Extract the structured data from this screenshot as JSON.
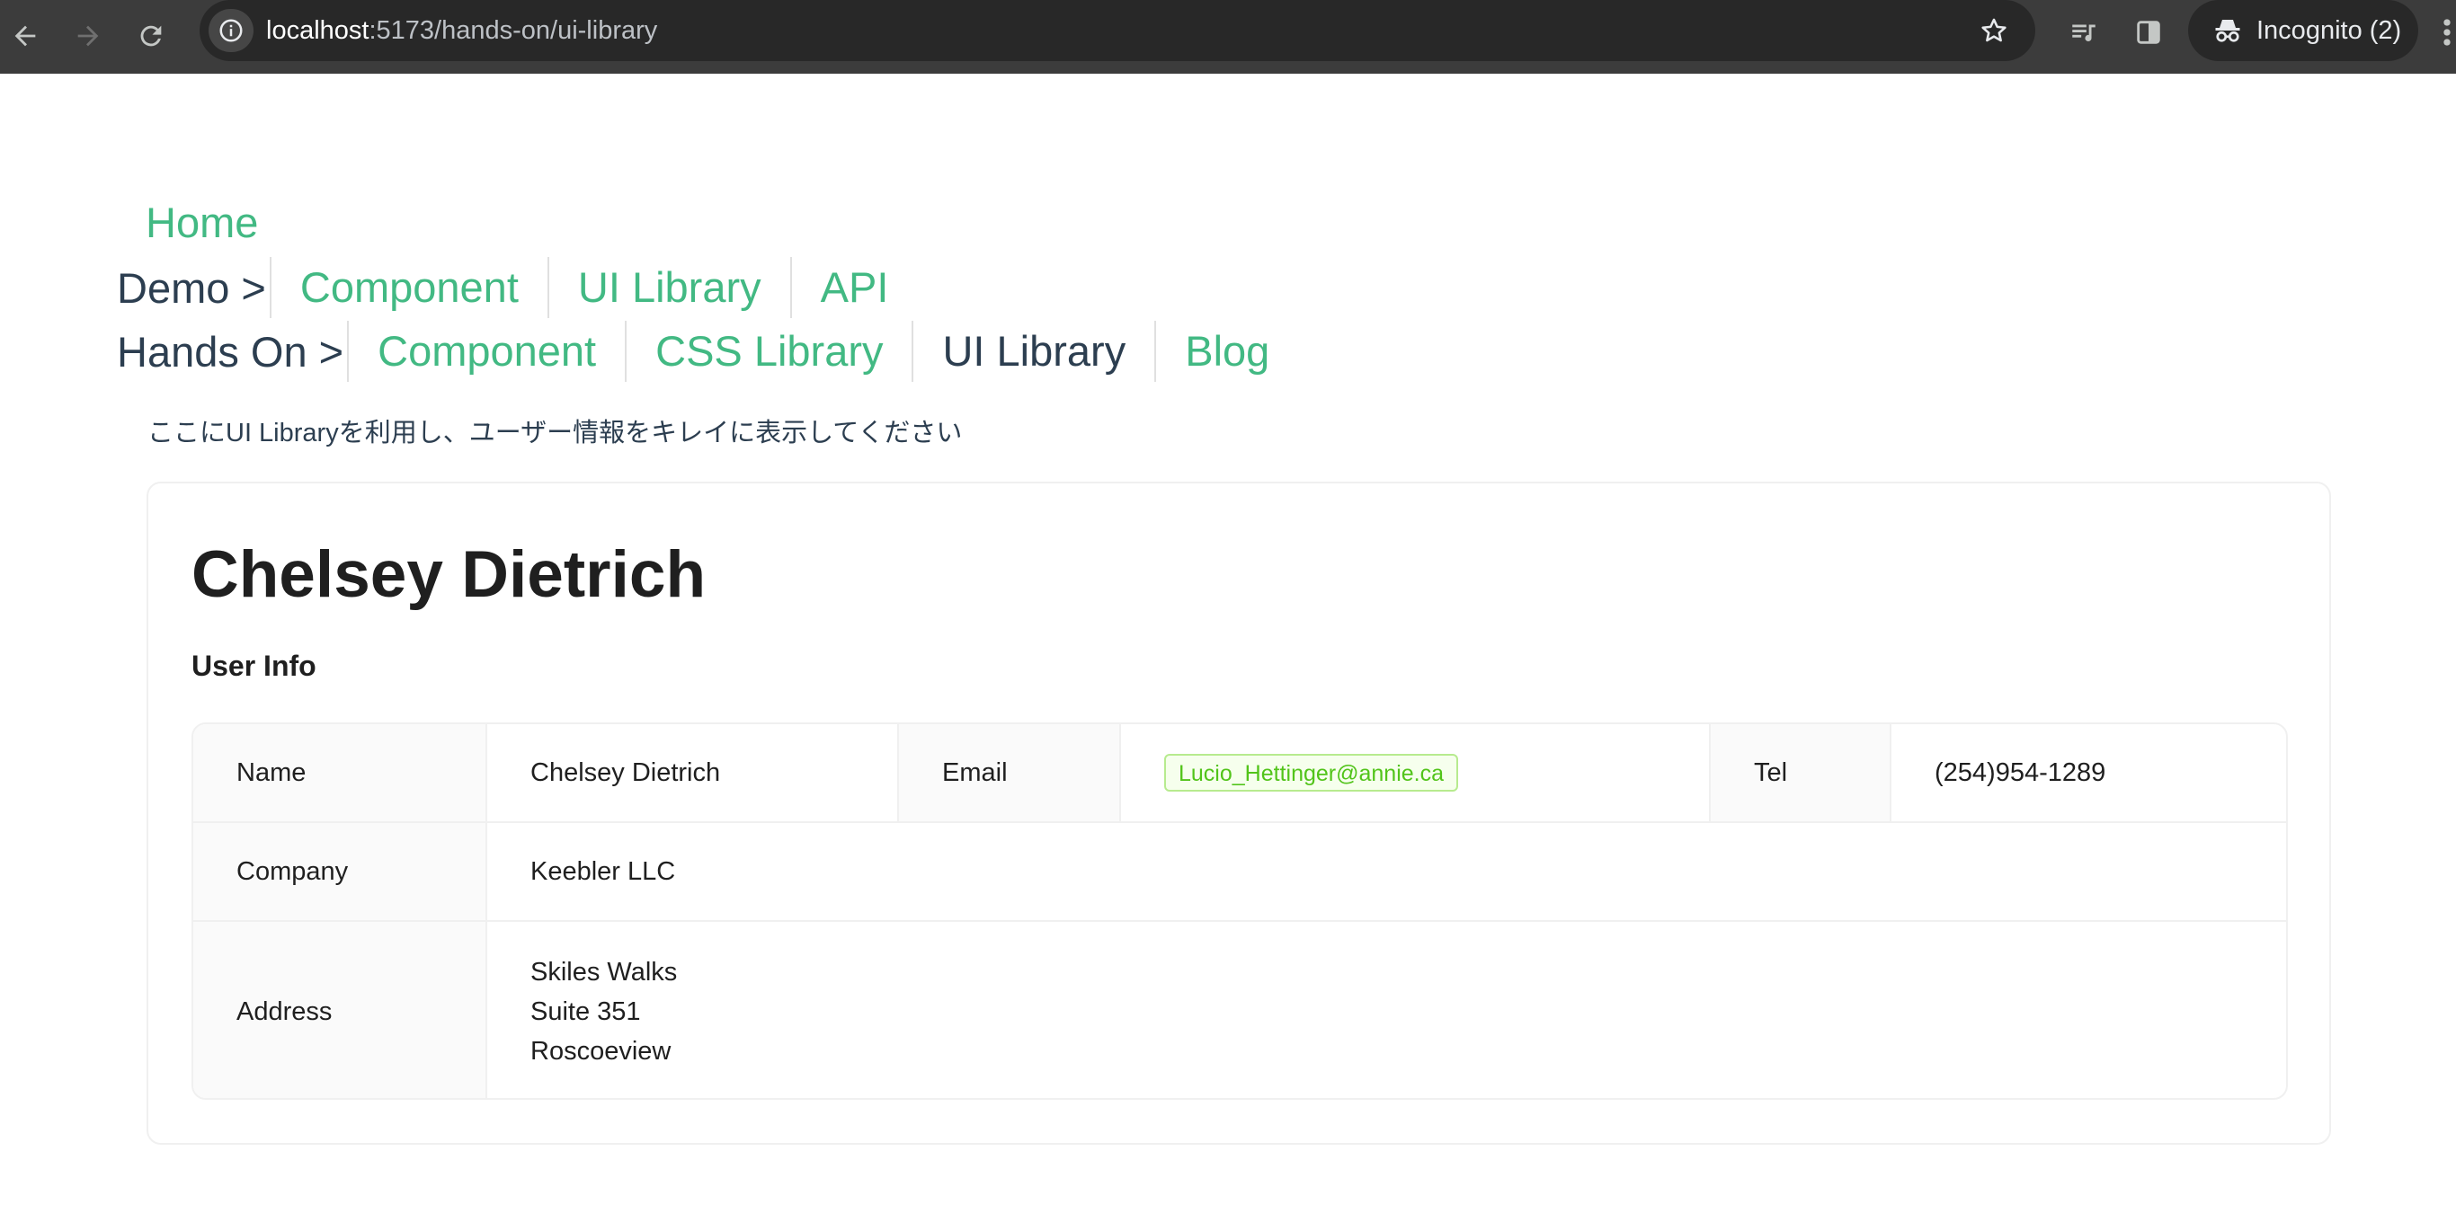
{
  "browser": {
    "url_host": "localhost",
    "url_path": ":5173/hands-on/ui-library",
    "incognito_label": "Incognito (2)"
  },
  "nav": {
    "home": "Home",
    "demo_label": "Demo >",
    "demo_links": [
      "Component",
      "UI Library",
      "API"
    ],
    "hands_on_label": "Hands On >",
    "hands_on_links": [
      "Component",
      "CSS Library",
      "UI Library",
      "Blog"
    ],
    "active_link": "UI Library"
  },
  "description": "ここにUI Libraryを利用し、ユーザー情報をキレイに表示してください",
  "card": {
    "title": "Chelsey Dietrich",
    "section_title": "User Info",
    "fields": {
      "name_label": "Name",
      "name_value": "Chelsey Dietrich",
      "email_label": "Email",
      "email_value": "Lucio_Hettinger@annie.ca",
      "tel_label": "Tel",
      "tel_value": "(254)954-1289",
      "company_label": "Company",
      "company_value": "Keebler LLC",
      "address_label": "Address",
      "address_lines": [
        "Skiles Walks",
        "Suite 351",
        "Roscoeview"
      ]
    }
  },
  "colors": {
    "link": "#42b983",
    "text": "#2c3e50",
    "tag_border": "#b7eb8f",
    "tag_bg": "#f6ffed",
    "tag_text": "#52c41a"
  },
  "icons": [
    "back-arrow-icon",
    "forward-arrow-icon",
    "reload-icon",
    "site-info-icon",
    "star-icon",
    "media-queue-icon",
    "side-panel-icon",
    "incognito-icon",
    "menu-icon"
  ]
}
